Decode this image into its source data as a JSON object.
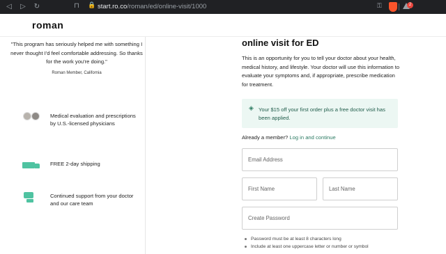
{
  "browser": {
    "url_host": "start.ro.co",
    "url_path": "/roman/ed/online-visit/1000",
    "rewards_count": "2",
    "icons": [
      "back-icon",
      "forward-icon",
      "reload-icon",
      "bookmark-icon",
      "lock-icon",
      "key-icon",
      "brave-shield-icon",
      "brave-rewards-icon"
    ]
  },
  "site": {
    "logo": "roman"
  },
  "testimonial": {
    "quote": "\"This program has seriously helped me with something I never thought I'd feel comfortable addressing. So thanks for the work you're doing.\"",
    "author": "Roman Member, California"
  },
  "features": [
    {
      "icon": "doctors-icon",
      "text": "Medical evaluation and prescriptions by U.S.-licensed physicians"
    },
    {
      "icon": "truck-icon",
      "text": "FREE 2-day shipping"
    },
    {
      "icon": "chat-icon",
      "text": "Continued support from your doctor and our care team"
    }
  ],
  "main": {
    "heading": "online visit for ED",
    "intro": "This is an opportunity for you to tell your doctor about your health, medical history, and lifestyle. Your doctor will use this information to evaluate your symptoms and, if appropriate, prescribe medication for treatment.",
    "promo": "Your $15 off your first order plus a free doctor visit has been applied.",
    "member_text": "Already a member?",
    "member_link": "Log in and continue",
    "email_placeholder": "Email Address",
    "first_name_placeholder": "First Name",
    "last_name_placeholder": "Last Name",
    "password_placeholder": "Create Password",
    "password_rules": [
      "Password must be at least 8 characters long",
      "Include at least one uppercase letter or number or symbol"
    ]
  },
  "colors": {
    "accent": "#2b7a62",
    "promo_bg": "#ecf7f3",
    "icon_green": "#4fc3a1",
    "chrome_bg": "#202124"
  }
}
